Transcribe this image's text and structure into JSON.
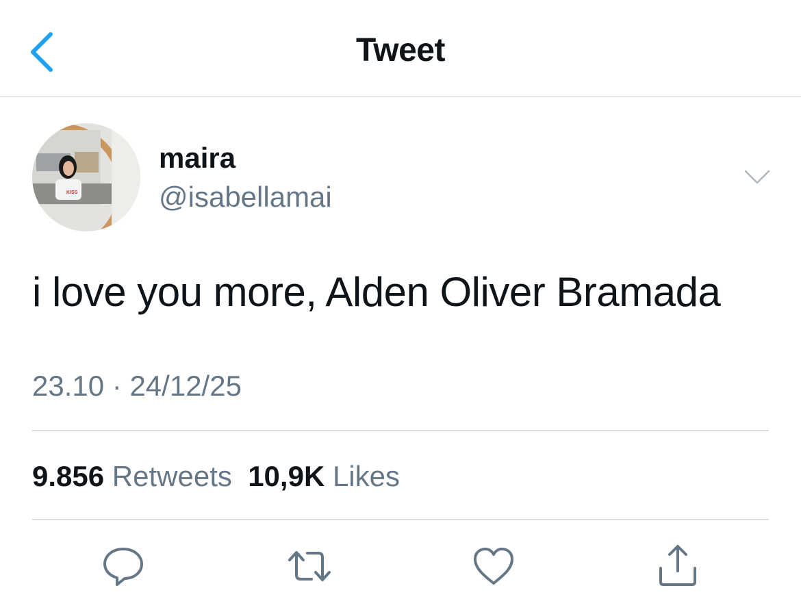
{
  "header": {
    "title": "Tweet",
    "back_icon": "chevron-left-icon",
    "accent": "#1da1f2"
  },
  "author": {
    "name": "maira",
    "handle": "@isabellamai",
    "avatar_shirt_text": "KISS"
  },
  "tweet": {
    "text": "i love you more, Alden Oliver Bramada",
    "time": "23.10",
    "separator": "·",
    "date": "24/12/25"
  },
  "stats": {
    "retweets_count": "9.856",
    "retweets_label": "Retweets",
    "likes_count": "10,9K",
    "likes_label": "Likes"
  },
  "actions": [
    {
      "icon": "reply-icon"
    },
    {
      "icon": "retweet-icon"
    },
    {
      "icon": "like-icon"
    },
    {
      "icon": "share-icon"
    }
  ],
  "colors": {
    "text": "#0f1419",
    "muted": "#657786",
    "divider": "#dadde1",
    "icon": "#657786"
  }
}
